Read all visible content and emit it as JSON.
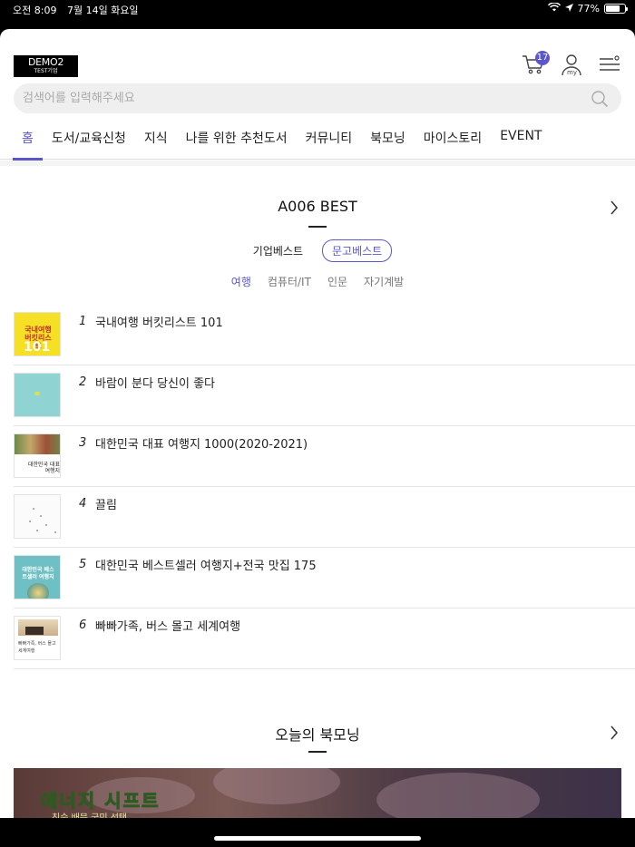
{
  "status": {
    "time": "오전 8:09",
    "date": "7월 14일 화요일",
    "battery": "77%",
    "battery_level": 0.77
  },
  "logo": {
    "line1": "DEMO2",
    "line2": "TEST기업"
  },
  "header": {
    "cart_count": "17"
  },
  "search": {
    "placeholder": "검색어를 입력해주세요",
    "value": ""
  },
  "nav": [
    {
      "label": "홈",
      "active": true
    },
    {
      "label": "도서/교육신청"
    },
    {
      "label": "지식"
    },
    {
      "label": "나를 위한 추천도서"
    },
    {
      "label": "커뮤니티"
    },
    {
      "label": "북모닝"
    },
    {
      "label": "마이스토리"
    },
    {
      "label": "EVENT"
    }
  ],
  "best": {
    "title": "A006 BEST",
    "tabs": [
      {
        "label": "기업베스트"
      },
      {
        "label": "문고베스트",
        "active": true
      }
    ],
    "subtabs": [
      {
        "label": "여행",
        "active": true
      },
      {
        "label": "컴퓨터/IT"
      },
      {
        "label": "인문"
      },
      {
        "label": "자기계발"
      }
    ],
    "books": [
      {
        "rank": "1",
        "title": "국내여행 버킷리스트 101",
        "cover_text": "국내여행 버킷리스트",
        "cover_number": "101"
      },
      {
        "rank": "2",
        "title": "바람이 분다 당신이 좋다"
      },
      {
        "rank": "3",
        "title": "대한민국 대표 여행지 1000(2020-2021)",
        "cover_text": "대한민국 대표 여행지"
      },
      {
        "rank": "4",
        "title": "끌림"
      },
      {
        "rank": "5",
        "title": "대한민국 베스트셀러 여행지+전국 맛집 175",
        "cover_text": "대한민국 베스트셀러 여행지"
      },
      {
        "rank": "6",
        "title": "빠빠가족, 버스 몰고 세계여행",
        "cover_text": "빠빠가족, 버스 몰고 세계여행"
      }
    ]
  },
  "bookmorning": {
    "title": "오늘의 북모닝",
    "banner_title": "에너지 시프트",
    "banner_sub": "친숙 배문 국민 선택"
  },
  "colors": {
    "accent": "#5b57c8",
    "divider": "#e5e5e5"
  }
}
